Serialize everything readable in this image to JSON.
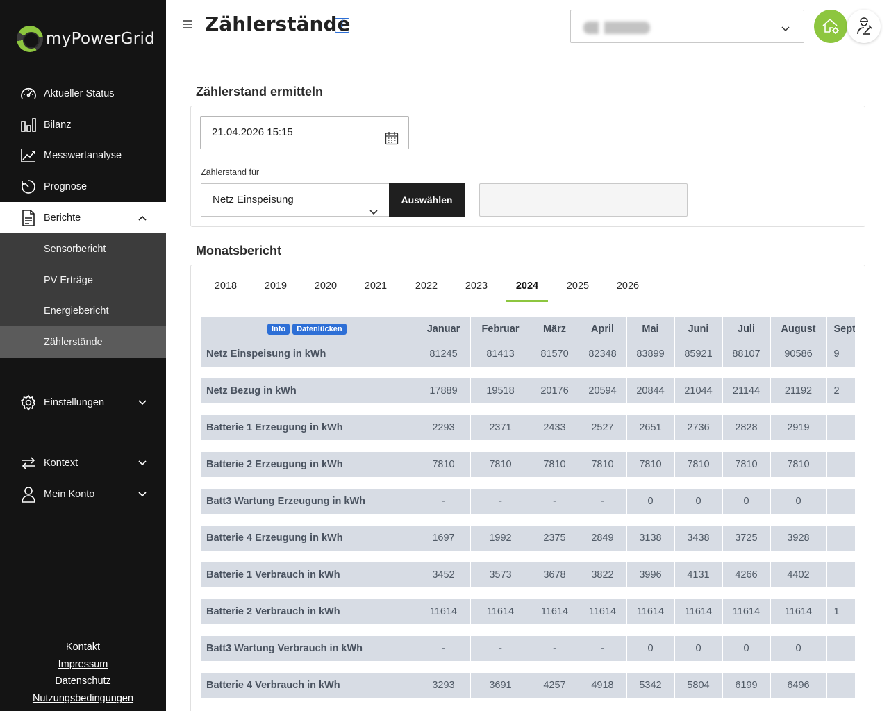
{
  "brand": {
    "name": "myPowerGrid",
    "accent": "#8dc63f"
  },
  "sidebar": {
    "items": [
      {
        "label": "Aktueller Status",
        "icon": "gauge-icon"
      },
      {
        "label": "Bilanz",
        "icon": "bar-chart-icon"
      },
      {
        "label": "Messwertanalyse",
        "icon": "line-chart-icon"
      },
      {
        "label": "Prognose",
        "icon": "clock-icon"
      },
      {
        "label": "Berichte",
        "icon": "document-icon"
      },
      {
        "label": "Einstellungen",
        "icon": "gear-icon"
      },
      {
        "label": "Kontext",
        "icon": "swap-arrows-icon"
      },
      {
        "label": "Mein Konto",
        "icon": "user-icon"
      }
    ],
    "subitems": [
      "Sensorbericht",
      "PV Erträge",
      "Energiebericht",
      "Zählerstände"
    ],
    "footer": [
      "Kontakt",
      "Impressum",
      "Datenschutz",
      "Nutzungsbedingungen"
    ]
  },
  "header": {
    "title": "Zählerstände",
    "info_icon": "info-icon"
  },
  "meter": {
    "section_title": "Zählerstand ermitteln",
    "datetime": "21.04.2026 15:15",
    "for_label": "Zählerstand für",
    "selected": "Netz Einspeisung",
    "button": "Auswählen"
  },
  "report": {
    "section_title": "Monatsbericht",
    "years": [
      "2018",
      "2019",
      "2020",
      "2021",
      "2022",
      "2023",
      "2024",
      "2025",
      "2026"
    ],
    "active_year": "2024",
    "badges": {
      "info": "Info",
      "gaps": "Datenlücken"
    },
    "months": [
      "Januar",
      "Februar",
      "März",
      "April",
      "Mai",
      "Juni",
      "Juli",
      "August",
      "September"
    ],
    "rows": [
      {
        "label": "Netz Einspeisung in kWh",
        "values": [
          "81245",
          "81413",
          "81570",
          "82348",
          "83899",
          "85921",
          "88107",
          "90586",
          "9"
        ]
      },
      {
        "label": "Netz Bezug in kWh",
        "values": [
          "17889",
          "19518",
          "20176",
          "20594",
          "20844",
          "21044",
          "21144",
          "21192",
          "2"
        ]
      },
      {
        "label": "Batterie 1 Erzeugung in kWh",
        "values": [
          "2293",
          "2371",
          "2433",
          "2527",
          "2651",
          "2736",
          "2828",
          "2919",
          ""
        ]
      },
      {
        "label": "Batterie 2 Erzeugung in kWh",
        "values": [
          "7810",
          "7810",
          "7810",
          "7810",
          "7810",
          "7810",
          "7810",
          "7810",
          ""
        ]
      },
      {
        "label": "Batt3 Wartung Erzeugung in kWh",
        "values": [
          "-",
          "-",
          "-",
          "-",
          "0",
          "0",
          "0",
          "0",
          ""
        ]
      },
      {
        "label": "Batterie 4 Erzeugung in kWh",
        "values": [
          "1697",
          "1992",
          "2375",
          "2849",
          "3138",
          "3438",
          "3725",
          "3928",
          ""
        ]
      },
      {
        "label": "Batterie 1 Verbrauch in kWh",
        "values": [
          "3452",
          "3573",
          "3678",
          "3822",
          "3996",
          "4131",
          "4266",
          "4402",
          ""
        ]
      },
      {
        "label": "Batterie 2 Verbrauch in kWh",
        "values": [
          "11614",
          "11614",
          "11614",
          "11614",
          "11614",
          "11614",
          "11614",
          "11614",
          "1"
        ]
      },
      {
        "label": "Batt3 Wartung Verbrauch in kWh",
        "values": [
          "-",
          "-",
          "-",
          "-",
          "0",
          "0",
          "0",
          "0",
          ""
        ]
      },
      {
        "label": "Batterie 4 Verbrauch in kWh",
        "values": [
          "3293",
          "3691",
          "4257",
          "4918",
          "5342",
          "5804",
          "6199",
          "6496",
          ""
        ]
      }
    ]
  }
}
